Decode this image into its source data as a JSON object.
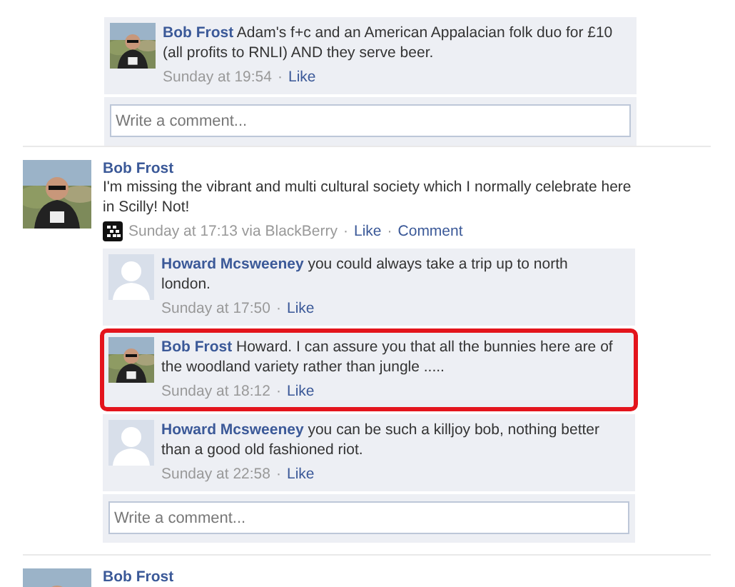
{
  "separator": "·",
  "posts": [
    {
      "comments": [
        {
          "author": "Bob Frost",
          "text": "Adam's f+c and an American Appalacian folk duo for £10 (all profits to RNLI) AND they serve beer.",
          "time": "Sunday at 19:54",
          "actions": [
            "Like"
          ],
          "highlighted": false
        }
      ],
      "comment_box": {
        "placeholder": "Write a comment..."
      }
    },
    {
      "author": "Bob Frost",
      "text": "I'm missing the vibrant and multi cultural society which I normally celebrate here in Scilly! Not!",
      "meta": {
        "via_icon": true,
        "time": "Sunday at 17:13 via BlackBerry",
        "actions": [
          "Like",
          "Comment"
        ]
      },
      "comments": [
        {
          "kind": "default",
          "author": "Howard Mcsweeney",
          "text": "you could always take a trip up to north london.",
          "time": "Sunday at 17:50",
          "actions": [
            "Like"
          ],
          "highlighted": false
        },
        {
          "author": "Bob Frost",
          "text": "Howard. I can assure you that all the bunnies here are of the woodland variety rather than jungle .....",
          "time": "Sunday at 18:12",
          "actions": [
            "Like"
          ],
          "highlighted": true
        },
        {
          "kind": "default",
          "author": "Howard Mcsweeney",
          "text": "you can be such a killjoy bob, nothing better than a good old fashioned riot.",
          "time": "Sunday at 22:58",
          "actions": [
            "Like"
          ],
          "highlighted": false
        }
      ],
      "comment_box": {
        "placeholder": "Write a comment..."
      }
    },
    {
      "author": "Bob Frost"
    }
  ]
}
